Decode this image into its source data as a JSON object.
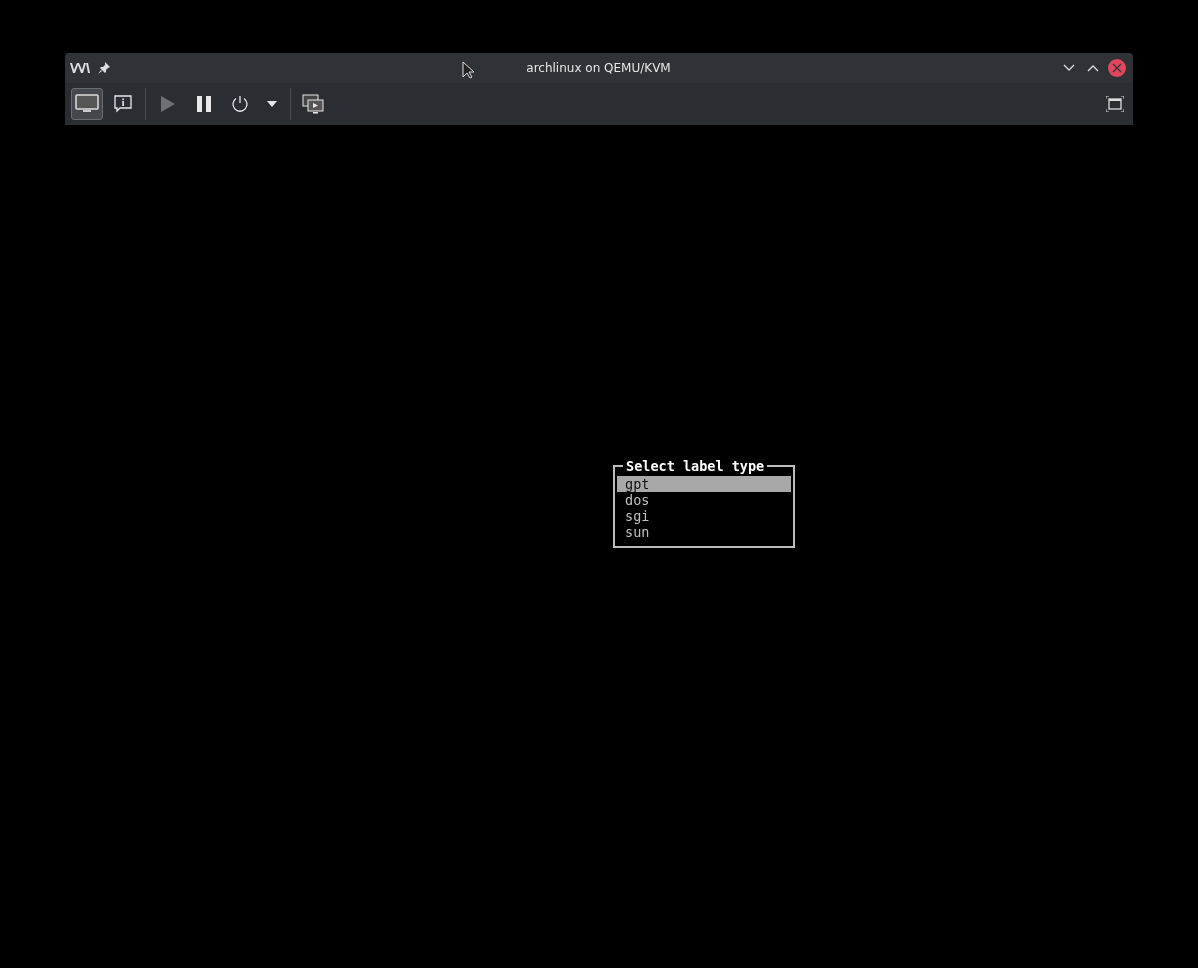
{
  "window": {
    "title": "archlinux on QEMU/KVM"
  },
  "toolbar": {
    "buttons": [
      {
        "kind": "console",
        "selected": true
      },
      {
        "kind": "details",
        "selected": false
      },
      {
        "kind": "run",
        "disabled": true
      },
      {
        "kind": "pause",
        "disabled": false
      },
      {
        "kind": "power",
        "disabled": false
      },
      {
        "kind": "menu",
        "disabled": false
      },
      {
        "kind": "snapshots",
        "disabled": false
      }
    ]
  },
  "dialog": {
    "title": "Select label type",
    "items": [
      {
        "label": "gpt",
        "selected": true
      },
      {
        "label": "dos",
        "selected": false
      },
      {
        "label": "sgi",
        "selected": false
      },
      {
        "label": "sun",
        "selected": false
      }
    ]
  }
}
